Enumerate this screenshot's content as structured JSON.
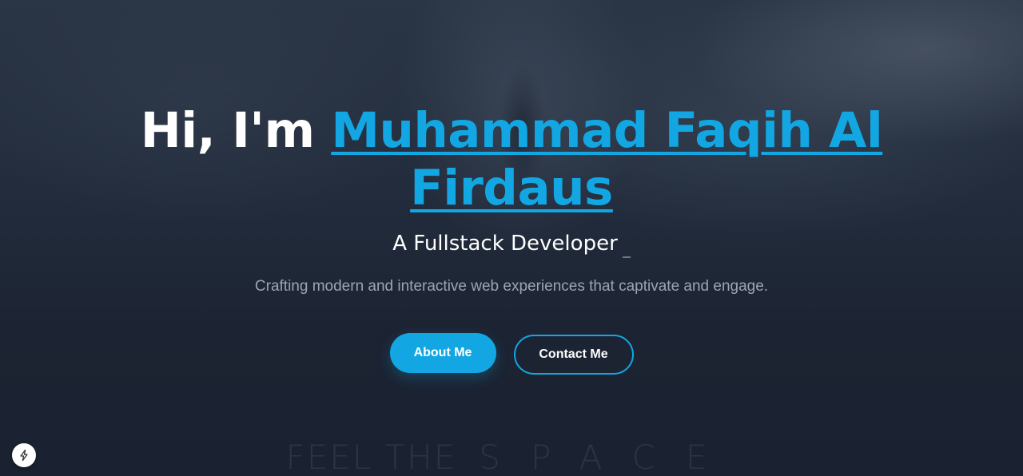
{
  "hero": {
    "greeting": "Hi, I'm ",
    "name": "Muhammad Faqih Al Firdaus",
    "role": "A Fullstack Developer",
    "tagline": "Crafting modern and interactive web experiences that captivate and engage."
  },
  "buttons": {
    "about_label": "About Me",
    "contact_label": "Contact Me"
  },
  "background_text": {
    "part1": "FEEL THE",
    "part2": "SPACE"
  },
  "badge": {
    "icon": "lightning-bolt-icon"
  },
  "colors": {
    "accent": "#12a7e3",
    "background": "#1b2332",
    "tagline": "#9aa5b4"
  }
}
